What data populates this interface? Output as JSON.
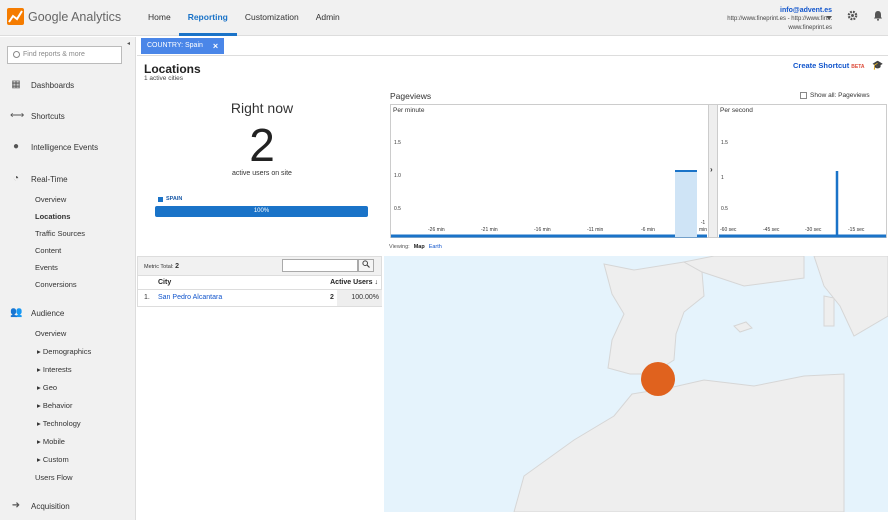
{
  "brand": {
    "name": "Google Analytics"
  },
  "nav": {
    "home": "Home",
    "reporting": "Reporting",
    "customization": "Customization",
    "admin": "Admin"
  },
  "account": {
    "email": "info@advent.es",
    "line2": "http://www.fineprint.es - http://www.fin...",
    "line3": "www.fineprint.es"
  },
  "sidebar": {
    "search_placeholder": "Find reports & more",
    "sections": {
      "dashboards": "Dashboards",
      "shortcuts": "Shortcuts",
      "intelligence": "Intelligence Events",
      "realtime": "Real-Time",
      "audience": "Audience",
      "acquisition": "Acquisition"
    },
    "realtime_items": [
      "Overview",
      "Locations",
      "Traffic Sources",
      "Content",
      "Events",
      "Conversions"
    ],
    "audience_items": [
      "Overview",
      "Demographics",
      "Interests",
      "Geo",
      "Behavior",
      "Technology",
      "Mobile",
      "Custom",
      "Users Flow"
    ]
  },
  "filter": {
    "label": "COUNTRY: Spain",
    "close": "×"
  },
  "page": {
    "title": "Locations",
    "subtitle": "1 active cities",
    "shortcut": "Create Shortcut",
    "beta": "BETA"
  },
  "rightnow": {
    "heading": "Right now",
    "count": "2",
    "label": "active users on site",
    "country": "SPAIN",
    "percent_label": "100%",
    "percent": 100
  },
  "pageviews": {
    "title": "Pageviews",
    "show_all": "Show all: Pageviews",
    "per_minute": "Per minute",
    "per_second": "Per second",
    "minute_ticks": [
      "1.5",
      "1.0",
      "0.5"
    ],
    "second_ticks": [
      "1.5",
      "1",
      "0.5"
    ],
    "minute_x": [
      "-26 min",
      "-21 min",
      "-16 min",
      "-11 min",
      "-6 min",
      "-1 min"
    ],
    "second_x": [
      "-60 sec",
      "-45 sec",
      "-30 sec",
      "-15 sec"
    ]
  },
  "viewing": {
    "label": "Viewing:",
    "map": "Map",
    "earth": "Earth"
  },
  "table": {
    "metric_label": "Metric Total:",
    "metric_total": "2",
    "col_city": "City",
    "col_users": "Active Users",
    "rows": [
      {
        "n": "1.",
        "city": "San Pedro Alcantara",
        "users": "2",
        "pct": "100.00%"
      }
    ]
  },
  "colors": {
    "accent": "#1a73c8",
    "marker": "#e0621e",
    "sea": "#e5f3fc",
    "land": "#eeeeee"
  },
  "icons": [
    "search-icon",
    "bell-icon",
    "gear-icon",
    "dashboards-icon",
    "shortcuts-icon",
    "intelligence-icon",
    "realtime-icon",
    "audience-icon",
    "acquisition-icon",
    "graduation-cap-icon"
  ]
}
